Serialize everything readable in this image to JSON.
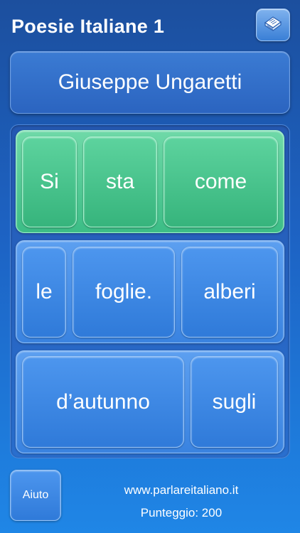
{
  "header": {
    "title": "Poesie Italiane 1",
    "menu_icon": "book-icon"
  },
  "author": "Giuseppe Ungaretti",
  "rows": [
    {
      "state": "correct",
      "words": [
        "Si",
        "sta",
        "come"
      ]
    },
    {
      "state": "pending",
      "words": [
        "le",
        "foglie.",
        "alberi"
      ]
    },
    {
      "state": "pending",
      "words": [
        "d’autunno",
        "sugli"
      ]
    }
  ],
  "footer": {
    "help_label": "Aiuto",
    "website": "www.parlareitaliano.it",
    "score_label": "Punteggio: 200"
  },
  "colors": {
    "background": "#1d63c4",
    "correct_row": "#3cbd86",
    "pending_row": "#3a83e0"
  }
}
